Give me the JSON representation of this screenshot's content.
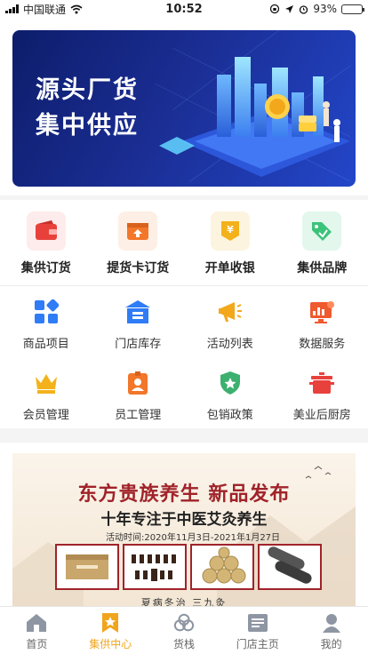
{
  "status_bar": {
    "carrier": "中国联通",
    "time": "10:52",
    "battery": "93%",
    "battery_level": 0.93
  },
  "banner": {
    "line1": "源头厂货",
    "line2": "集中供应"
  },
  "quick_actions": [
    {
      "label": "集供订货",
      "icon": "wallet-icon",
      "color": "#e8413c"
    },
    {
      "label": "提货卡订货",
      "icon": "upload-box-icon",
      "color": "#f2772a"
    },
    {
      "label": "开单收银",
      "icon": "cashier-icon",
      "color": "#f3b21c"
    },
    {
      "label": "集供品牌",
      "icon": "price-tag-icon",
      "color": "#3cc37a"
    }
  ],
  "grid": [
    {
      "label": "商品项目",
      "icon": "apps-icon"
    },
    {
      "label": "门店库存",
      "icon": "store-icon"
    },
    {
      "label": "活动列表",
      "icon": "megaphone-icon"
    },
    {
      "label": "数据服务",
      "icon": "monitor-chart-icon"
    },
    {
      "label": "会员管理",
      "icon": "crown-icon"
    },
    {
      "label": "员工管理",
      "icon": "badge-icon"
    },
    {
      "label": "包销政策",
      "icon": "shield-star-icon"
    },
    {
      "label": "美业后厨房",
      "icon": "pot-icon"
    }
  ],
  "promo": {
    "title": "东方贵族养生 新品发布",
    "subtitle": "十年专注于中医艾灸养生",
    "date": "活动时间:2020年11月3日-2021年1月27日",
    "footer": "夏病冬治 三九灸"
  },
  "tabs": [
    {
      "label": "首页",
      "icon": "home-icon",
      "active": false
    },
    {
      "label": "集供中心",
      "icon": "star-flag-icon",
      "active": true
    },
    {
      "label": "货栈",
      "icon": "warehouse-icon",
      "active": false
    },
    {
      "label": "门店主页",
      "icon": "storefront-icon",
      "active": false
    },
    {
      "label": "我的",
      "icon": "user-icon",
      "active": false
    }
  ]
}
